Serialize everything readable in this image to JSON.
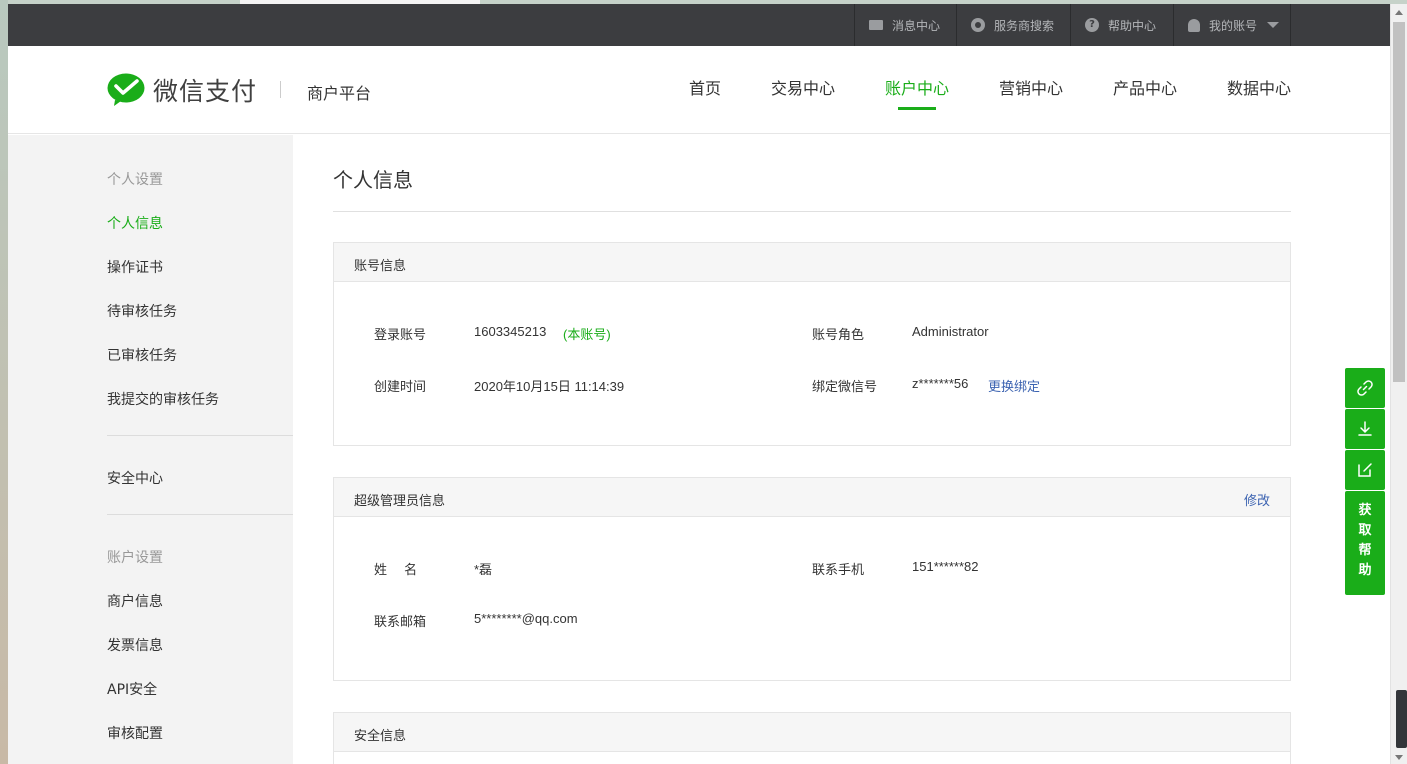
{
  "topbar": {
    "messages": "消息中心",
    "provider_search": "服务商搜索",
    "help": "帮助中心",
    "account": "我的账号"
  },
  "header": {
    "logo": "微信支付",
    "subtitle": "商户平台",
    "nav": [
      "首页",
      "交易中心",
      "账户中心",
      "营销中心",
      "产品中心",
      "数据中心"
    ],
    "active_nav": "账户中心"
  },
  "sidebar": {
    "group1": "个人设置",
    "items1": [
      "个人信息",
      "操作证书",
      "待审核任务",
      "已审核任务",
      "我提交的审核任务"
    ],
    "security": "安全中心",
    "group2": "账户设置",
    "items2": [
      "商户信息",
      "发票信息",
      "API安全",
      "审核配置"
    ]
  },
  "main": {
    "title": "个人信息",
    "account_panel": {
      "title": "账号信息",
      "login_label": "登录账号",
      "login_value": "1603345213",
      "login_tag": "(本账号)",
      "role_label": "账号角色",
      "role_value": "Administrator",
      "created_label": "创建时间",
      "created_value": "2020年10月15日 11:14:39",
      "wechat_label": "绑定微信号",
      "wechat_value": "z*******56",
      "wechat_action": "更换绑定"
    },
    "admin_panel": {
      "title": "超级管理员信息",
      "action": "修改",
      "name_label": "姓　 名",
      "name_value": "*磊",
      "phone_label": "联系手机",
      "phone_value": "151******82",
      "email_label": "联系邮箱",
      "email_value": "5********@qq.com"
    },
    "security_panel": {
      "title": "安全信息"
    }
  },
  "float_bar": {
    "help_chars": [
      "获",
      "取",
      "帮",
      "助"
    ]
  },
  "colors": {
    "brand_green": "#1aad19",
    "link_blue": "#3c63b1",
    "topbar_bg": "#3c3d40",
    "sidebar_bg": "#f3f3f3"
  }
}
